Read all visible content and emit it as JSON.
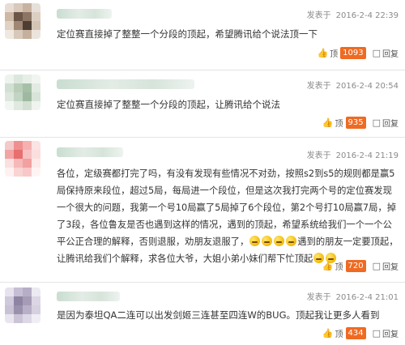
{
  "comments": [
    {
      "time_label": "发表于",
      "time": "2016-2-4 22:39",
      "text": "定位赛直接掉了整整一个分段的顶起，希望腾讯给个说法顶一下",
      "like_label": "顶",
      "like_count": "1093",
      "reply_label": "回复"
    },
    {
      "time_label": "发表于",
      "time": "2016-2-4 20:54",
      "text": "定位赛直接掉了整整一个分段的顶起，让腾讯给个说法",
      "like_label": "顶",
      "like_count": "935",
      "reply_label": "回复"
    },
    {
      "time_label": "发表于",
      "time": "2016-2-4 21:19",
      "text_part1": "各位，定级赛都打完了吗，有没有发现有些情况不对劲，按照s2到s5的规则都是赢5局保持原来段位，超过5局，每局进一个段位，但是这次我打完两个号的定位赛发现一个很大的问题，我第一个号10局赢了5局掉了6个段位，第2个号打10局赢7局，掉了3段，各位鲁友是否也遇到这样的情况，遇到的顶起，希望系统给我们一个一个公平公正合理的解释，否则退服，劝朋友退服了，",
      "text_part2": "遇到的朋友一定要顶起，让腾讯给我们个解释，求各位大爷，大姐小弟小妹们帮下忙顶起",
      "like_label": "顶",
      "like_count": "720",
      "reply_label": "回复"
    },
    {
      "time_label": "发表于",
      "time": "2016-2-4 21:01",
      "text": "是因为泰坦QA二连可以出发剑姬三连甚至四连W的BUG。顶起我让更多人看到",
      "like_label": "顶",
      "like_count": "434",
      "reply_label": "回复"
    }
  ],
  "icons": {
    "like": "thumbs-up-icon",
    "reply": "reply-icon",
    "emoji": "doge-emoji-icon"
  },
  "colors": {
    "count_badge": "#ef6a22",
    "thumb": "#e0483a",
    "meta": "#8a8a8a"
  }
}
